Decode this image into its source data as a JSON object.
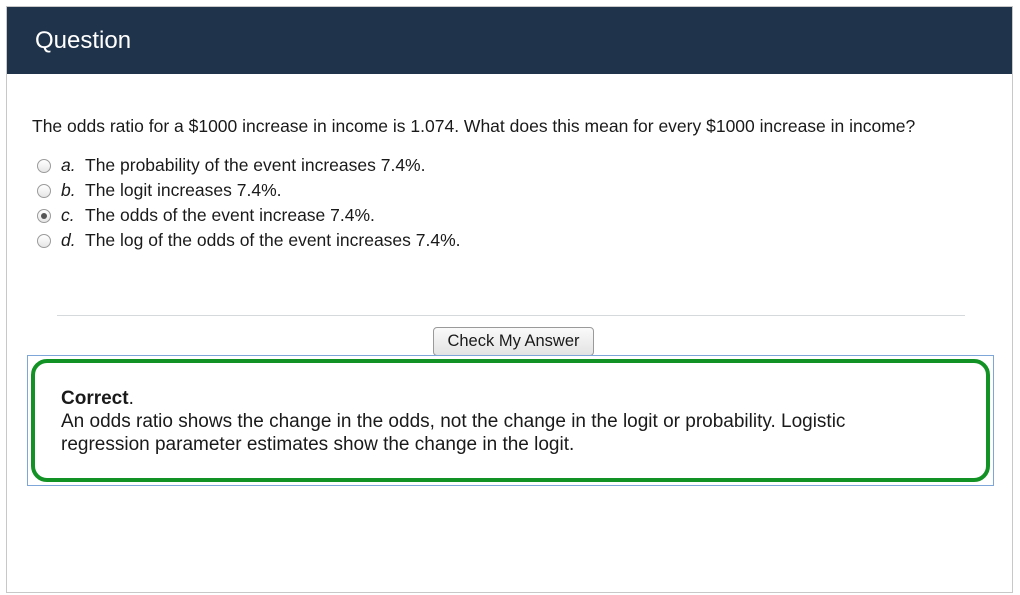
{
  "header": {
    "title": "Question"
  },
  "question": {
    "text": "The odds ratio for a $1000 increase in income is 1.074. What does this mean for every $1000 increase in income?",
    "choices": [
      {
        "letter": "a.",
        "text": "The probability of the event increases 7.4%.",
        "selected": false
      },
      {
        "letter": "b.",
        "text": "The logit increases 7.4%.",
        "selected": false
      },
      {
        "letter": "c.",
        "text": "The odds of the event increase 7.4%.",
        "selected": true
      },
      {
        "letter": "d.",
        "text": "The log of the odds of the event increases 7.4%.",
        "selected": false
      }
    ]
  },
  "actions": {
    "check_label": "Check My Answer"
  },
  "feedback": {
    "status": "Correct",
    "status_punct": ".",
    "line1": "An odds ratio shows the change in the odds, not the change in the logit or probability. Logistic",
    "line2": "regression parameter estimates show the change in the logit."
  },
  "colors": {
    "header_bg": "#1f334b",
    "feedback_border": "#129124"
  }
}
